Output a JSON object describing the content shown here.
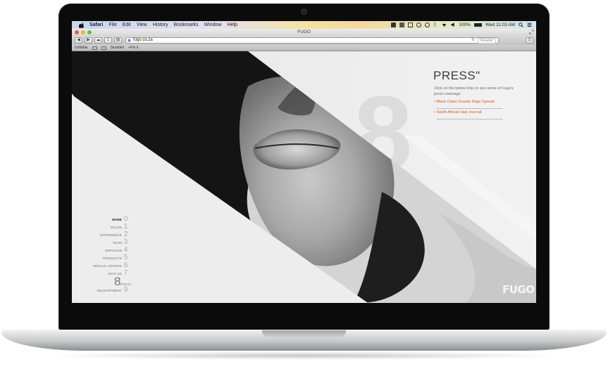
{
  "menubar": {
    "items": [
      "Safari",
      "File",
      "Edit",
      "View",
      "History",
      "Bookmarks",
      "Window",
      "Help"
    ],
    "battery": "100%",
    "clock": "Wed 11:03 AM"
  },
  "window": {
    "title": "FUGO"
  },
  "toolbar": {
    "url": "fugo.co.za",
    "reader_label": "Reader"
  },
  "bookmarks": [
    "Dribbble",
    "Stumble!",
    "+Pin it"
  ],
  "page": {
    "press_title": "PRESS\"",
    "big_number": "8",
    "press_description": "Click on the below links to see some of Fugo's press coverage",
    "press_links": [
      "• Marie Claire Double Page Spread",
      "• South African Hair Journal"
    ],
    "nav": [
      {
        "label": "HOME",
        "num": "0"
      },
      {
        "label": "SALON",
        "num": "1"
      },
      {
        "label": "EXPERIENCE",
        "num": "2"
      },
      {
        "label": "TEAM",
        "num": "3"
      },
      {
        "label": "SERVICES",
        "num": "4"
      },
      {
        "label": "PRODUCTS",
        "num": "5"
      },
      {
        "label": "SPECIAL OFFERS",
        "num": "6"
      },
      {
        "label": "VISIT US",
        "num": "7"
      },
      {
        "label": "",
        "num": "8"
      },
      {
        "label": "RECRUITMENT",
        "num": "9"
      }
    ],
    "nav_active_extra": "PRESS",
    "logo": "FUGO"
  }
}
